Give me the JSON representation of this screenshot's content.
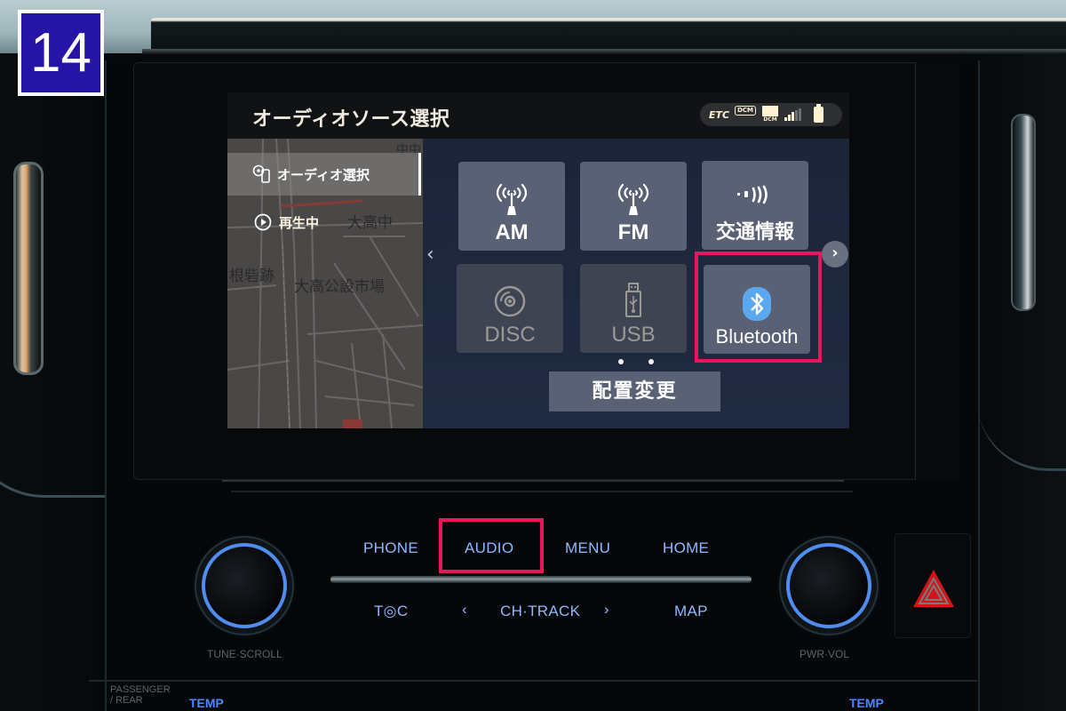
{
  "step_badge": {
    "number": "14",
    "color": "#2614a6"
  },
  "screen": {
    "title": "オーディオソース選択",
    "status": {
      "etc_label": "ETC",
      "dcm_label": "DCM",
      "dcm_small_label": "DCM",
      "signal_bars_lit": 3,
      "signal_bars_total": 5
    },
    "side_menu": [
      {
        "label": "オーディオ選択",
        "icon": "audio-select-icon",
        "selected": true
      },
      {
        "label": "再生中",
        "icon": "play-circle-icon",
        "selected": false
      }
    ],
    "map_labels": [
      "大高中",
      "大高公設市場",
      "根砦跡",
      "中中"
    ],
    "sources": [
      {
        "label": "AM",
        "icon": "antenna-icon",
        "enabled": true
      },
      {
        "label": "FM",
        "icon": "antenna-icon",
        "enabled": true
      },
      {
        "label": "交通情報",
        "icon": "traffic-info-icon",
        "enabled": true
      },
      {
        "label": "DISC",
        "icon": "disc-icon",
        "enabled": false
      },
      {
        "label": "USB",
        "icon": "usb-icon",
        "enabled": false
      },
      {
        "label": "Bluetooth",
        "icon": "bluetooth-icon",
        "enabled": true,
        "highlighted": true
      }
    ],
    "nav_prev": "‹",
    "nav_next": "›",
    "page_count": 2,
    "rearrange_label": "配置変更"
  },
  "hardware": {
    "top_row": [
      "PHONE",
      "AUDIO",
      "MENU",
      "HOME"
    ],
    "bottom_row": {
      "tc": "T◎C",
      "prev": "‹",
      "ch_track": "CH·TRACK",
      "next": "›",
      "map": "MAP"
    },
    "left_knob_label": "TUNE·SCROLL",
    "right_knob_label": "PWR·VOL",
    "highlighted_button": "AUDIO",
    "passenger_label_1": "PASSENGER",
    "passenger_label_2": "/ REAR",
    "temp_left": "TEMP",
    "temp_right": "TEMP"
  },
  "colors": {
    "highlight": "#e8175d",
    "hardware_text": "#8fb8ff",
    "tile": "#5a6175",
    "bluetooth_blue": "#5aa8f0"
  }
}
